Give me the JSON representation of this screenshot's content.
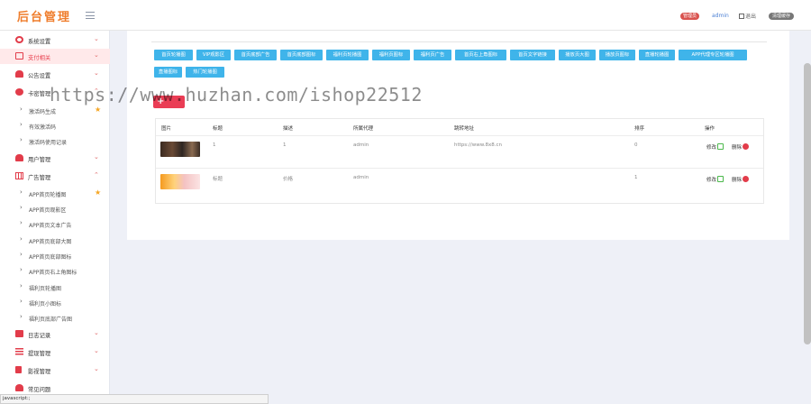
{
  "header": {
    "logo": "后台管理",
    "badge": "管理员",
    "user": "admin",
    "logout": "退出",
    "cache": "清理缓存"
  },
  "sidebar": {
    "items": [
      {
        "label": "系统设置",
        "icon": "gear-icon"
      },
      {
        "label": "支付相关",
        "icon": "card-icon"
      },
      {
        "label": "公告设置",
        "icon": "bell-icon"
      },
      {
        "label": "卡密管理",
        "icon": "globe-icon"
      },
      {
        "label": "激活码生成",
        "starred": true
      },
      {
        "label": "有效激活码"
      },
      {
        "label": "激活码使用记录"
      },
      {
        "label": "用户管理",
        "icon": "users-icon"
      },
      {
        "label": "广告管理",
        "icon": "grid-icon"
      },
      {
        "label": "APP首页轮播图",
        "starred": true
      },
      {
        "label": "APP首页观影区"
      },
      {
        "label": "APP首页文本广告"
      },
      {
        "label": "APP首页底部大图"
      },
      {
        "label": "APP首页底部图标"
      },
      {
        "label": "APP首页右上角图标"
      },
      {
        "label": "福利页轮播图"
      },
      {
        "label": "福利页小图标"
      },
      {
        "label": "福利页底部广告图"
      },
      {
        "label": "日志记录",
        "icon": "printer-icon"
      },
      {
        "label": "提现管理",
        "icon": "list-icon"
      },
      {
        "label": "影视管理",
        "icon": "video-icon"
      },
      {
        "label": "常见问题",
        "icon": "person-icon"
      }
    ]
  },
  "tabs": [
    "首页轮播图",
    "VIP观影区",
    "首页底部广告",
    "首页底部图标",
    "福利页轮播图",
    "福利页图标",
    "福利页广告",
    "首页右上角图标",
    "首页文字链接",
    "播放页大图",
    "播放页图标",
    "直播轮播图",
    "APP代理专区轮播图",
    "直播图标",
    "热门轮播图"
  ],
  "table": {
    "headers": [
      "图片",
      "标题",
      "描述",
      "所属代理",
      "跳转地址",
      "排序",
      "操作"
    ],
    "rows": [
      {
        "title": "1",
        "desc": "1",
        "agent": "admin",
        "url": "https://www.8x8.cn",
        "sort": "0",
        "thumb": "dark"
      },
      {
        "title": "标题",
        "desc": "价格",
        "agent": "admin",
        "url": "",
        "sort": "1",
        "thumb": "light"
      }
    ],
    "edit_label": "修改",
    "delete_label": "删除"
  },
  "watermark": "https://www.huzhan.com/ishop22512",
  "status_text": "javascript:;"
}
